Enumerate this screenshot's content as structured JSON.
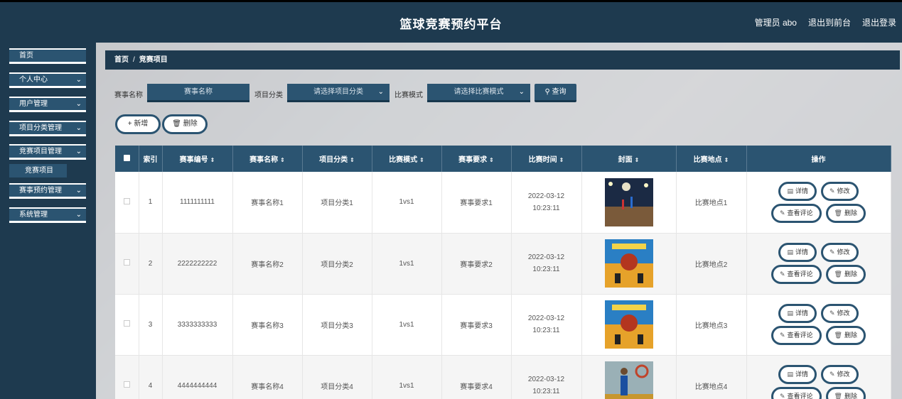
{
  "header": {
    "title": "篮球竞赛预约平台",
    "admin": "管理员 abo",
    "back_front": "退出到前台",
    "logout": "退出登录"
  },
  "sidebar": {
    "items": [
      {
        "label": "首页",
        "has_chevron": false
      },
      {
        "label": "个人中心",
        "has_chevron": true
      },
      {
        "label": "用户管理",
        "has_chevron": true
      },
      {
        "label": "项目分类管理",
        "has_chevron": true
      },
      {
        "label": "竞赛项目管理",
        "has_chevron": true
      },
      {
        "label": "赛事预约管理",
        "has_chevron": true
      },
      {
        "label": "系统管理",
        "has_chevron": true
      }
    ],
    "submenu_label": "竞赛项目",
    "chevron": "⌄"
  },
  "breadcrumb": {
    "home": "首页",
    "separator": "/",
    "current": "竞赛项目"
  },
  "search": {
    "name_label": "赛事名称",
    "name_placeholder": "赛事名称",
    "category_label": "项目分类",
    "category_placeholder": "请选择项目分类",
    "mode_label": "比赛模式",
    "mode_placeholder": "请选择比赛模式",
    "query_button": "查询",
    "query_icon": "search-icon"
  },
  "actions": {
    "add_label": "新增",
    "delete_label": "删除"
  },
  "table": {
    "headers": {
      "index": "索引",
      "code": "赛事编号",
      "name": "赛事名称",
      "category": "项目分类",
      "mode": "比赛模式",
      "requirement": "赛事要求",
      "time": "比赛时间",
      "cover": "封面",
      "location": "比赛地点",
      "ops": "操作"
    },
    "sort_glyph": "⇕",
    "op_labels": {
      "detail": "详情",
      "edit": "修改",
      "comments": "查看评论",
      "delete": "删除"
    },
    "rows": [
      {
        "index": "1",
        "code": "1111111111",
        "name": "赛事名称1",
        "category": "项目分类1",
        "mode": "1vs1",
        "requirement": "赛事要求1",
        "time": "2022-03-12 10:23:11",
        "location": "比赛地点1",
        "cover": "arena"
      },
      {
        "index": "2",
        "code": "2222222222",
        "name": "赛事名称2",
        "category": "项目分类2",
        "mode": "1vs1",
        "requirement": "赛事要求2",
        "time": "2022-03-12 10:23:11",
        "location": "比赛地点2",
        "cover": "poster"
      },
      {
        "index": "3",
        "code": "3333333333",
        "name": "赛事名称3",
        "category": "项目分类3",
        "mode": "1vs1",
        "requirement": "赛事要求3",
        "time": "2022-03-12 10:23:11",
        "location": "比赛地点3",
        "cover": "poster"
      },
      {
        "index": "4",
        "code": "4444444444",
        "name": "赛事名称4",
        "category": "项目分类4",
        "mode": "1vs1",
        "requirement": "赛事要求4",
        "time": "2022-03-12 10:23:11",
        "location": "比赛地点4",
        "cover": "dunk"
      }
    ]
  }
}
